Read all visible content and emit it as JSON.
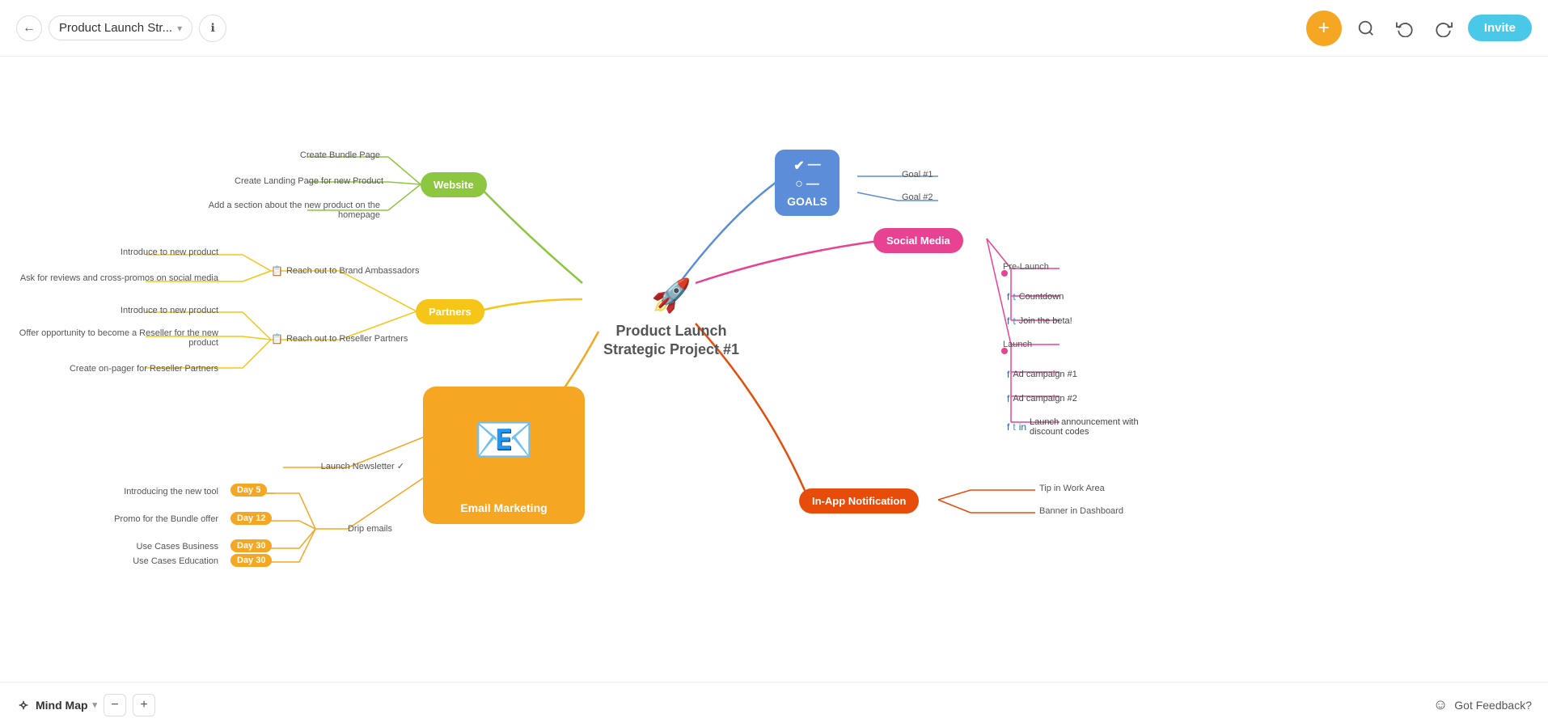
{
  "header": {
    "back_label": "←",
    "title": "Product Launch Str...",
    "title_dropdown": "▾",
    "info_icon": "ℹ",
    "add_icon": "+",
    "search_icon": "🔍",
    "undo_icon": "↩",
    "redo_icon": "↪",
    "invite_label": "Invite"
  },
  "footer": {
    "mind_map_label": "Mind Map",
    "mind_map_dropdown": "▾",
    "zoom_out_label": "−",
    "zoom_in_label": "+",
    "feedback_icon": "☺",
    "feedback_label": "Got Feedback?"
  },
  "canvas": {
    "center_node": {
      "title_line1": "Product Launch",
      "title_line2": "Strategic Project #1"
    },
    "goals_node": {
      "label": "GOALS",
      "goal1": "Goal #1",
      "goal2": "Goal #2"
    },
    "social_media_node": {
      "label": "Social Media",
      "pre_launch": "Pre-Launch",
      "launch": "Launch",
      "items": [
        {
          "icons": [
            "fb",
            "tw"
          ],
          "text": "Countdown"
        },
        {
          "icons": [
            "fb",
            "tw"
          ],
          "text": "Join the beta!"
        },
        {
          "icons": [
            "fb"
          ],
          "text": "Ad campaign #1"
        },
        {
          "icons": [
            "fb"
          ],
          "text": "Ad campaign #2"
        },
        {
          "icons": [
            "fb",
            "tw",
            "li"
          ],
          "text": "Launch announcement with discount codes"
        }
      ]
    },
    "in_app_node": {
      "label": "In-App Notification",
      "items": [
        "Tip in Work Area",
        "Banner in Dashboard"
      ]
    },
    "website_node": {
      "label": "Website",
      "items": [
        "Create Bundle Page",
        "Create Landing Page for new Product",
        "Add a section about the new product on the homepage"
      ]
    },
    "partners_node": {
      "label": "Partners",
      "items": [
        {
          "icon": "📋",
          "text": "Reach out to Brand Ambassadors",
          "sub": [
            "Introduce to new product",
            "Ask for reviews and cross-promos on social media"
          ]
        },
        {
          "icon": "📋",
          "text": "Reach out to Reseller Partners",
          "sub": [
            "Introduce to new product",
            "Offer opportunity to become a Reseller for the new product",
            "Create on-pager for Reseller Partners"
          ]
        }
      ]
    },
    "email_node": {
      "label": "Email Marketing",
      "items": [
        {
          "text": "Launch Newsletter",
          "has_check": true
        },
        {
          "text": "Drip emails",
          "sub": [
            {
              "text": "Introducing the new tool",
              "day": "Day 5"
            },
            {
              "text": "Promo for the Bundle offer",
              "day": "Day 12"
            },
            {
              "text": "Use Cases Business",
              "day": "Day 30"
            },
            {
              "text": "Use Cases Education",
              "day": "Day 30"
            }
          ]
        }
      ]
    }
  },
  "colors": {
    "goals_blue": "#5b8dd9",
    "social_pink": "#e84393",
    "in_app_orange": "#e84c0a",
    "website_green": "#8dc63f",
    "partners_yellow": "#f5c518",
    "email_orange": "#f5a623",
    "center_line": "#88c8e8"
  }
}
